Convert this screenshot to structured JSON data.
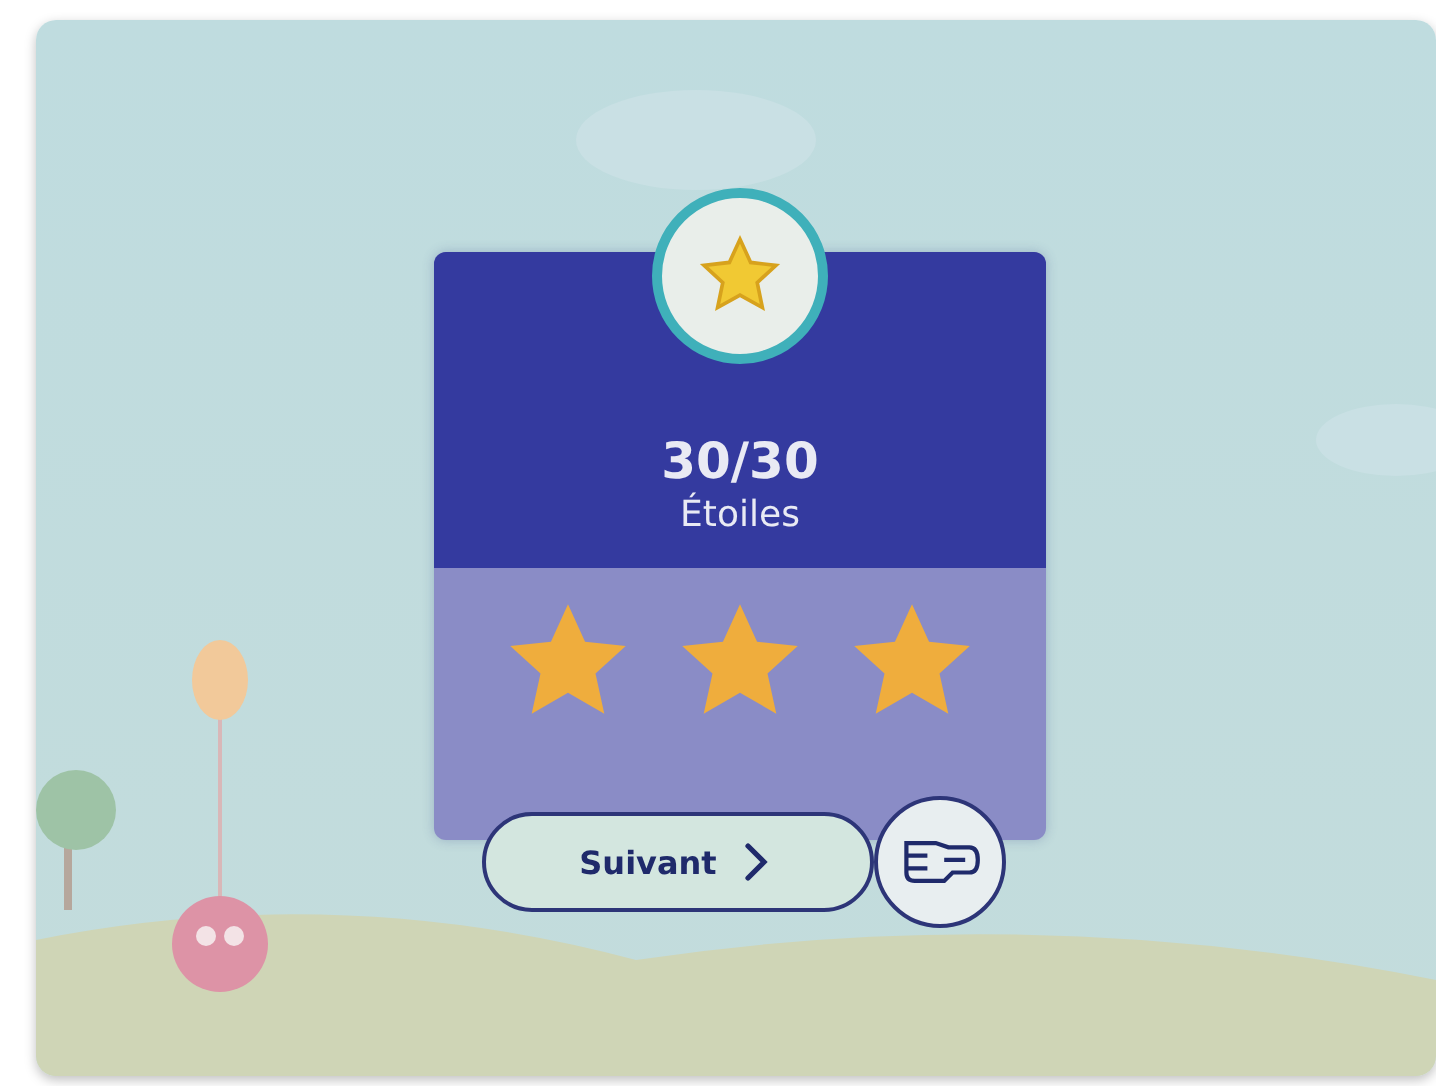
{
  "result": {
    "score": "30/30",
    "label": "Étoiles"
  },
  "rating": {
    "stars": 3
  },
  "button": {
    "label": "Suivant"
  }
}
